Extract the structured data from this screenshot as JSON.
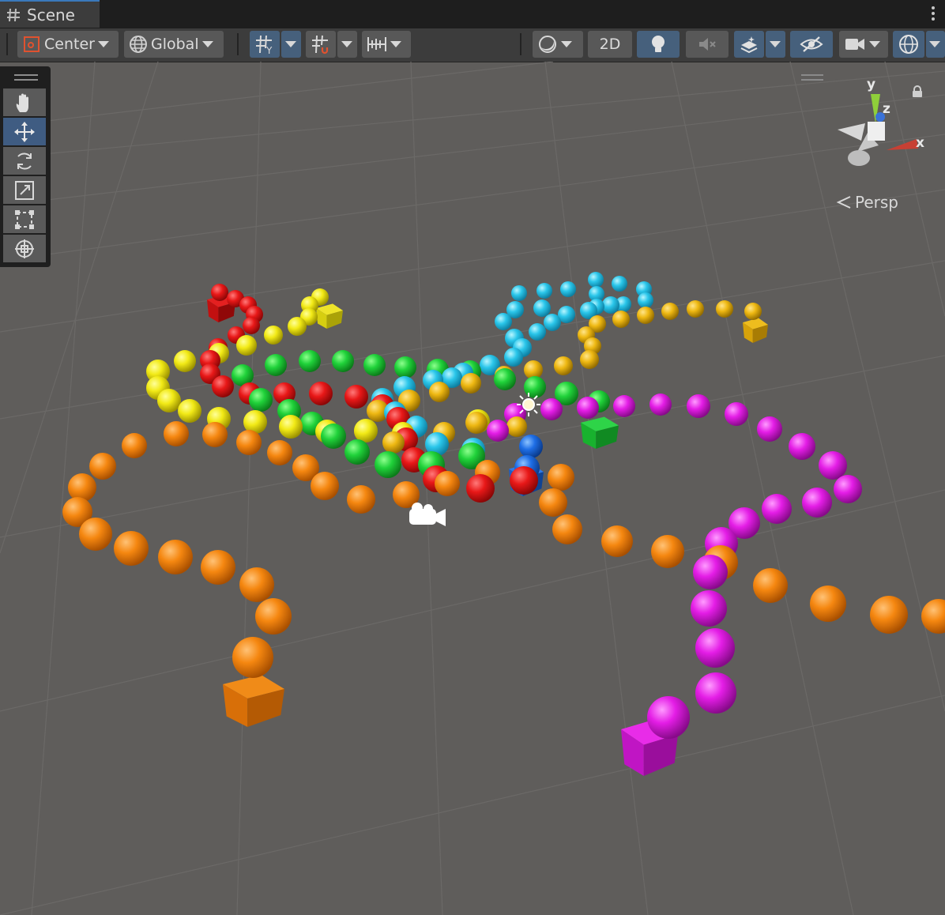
{
  "tab": {
    "label": "Scene",
    "icon": "grid-hash-icon"
  },
  "toolbar": {
    "pivot_label": "Center",
    "space_label": "Global",
    "mode_2d_label": "2D"
  },
  "tools": [
    "hand-tool",
    "move-tool",
    "rotate-tool",
    "scale-tool",
    "rect-tool",
    "transform-tool"
  ],
  "gizmo": {
    "y_label": "y",
    "z_label": "z",
    "x_label": "x",
    "projection_label": "Persp"
  },
  "colors": {
    "background": "#5f5d5b",
    "toolbar": "#3c3c3c",
    "active_button": "#46607c",
    "red": "#e01919",
    "yellow": "#f0e619",
    "green": "#1ed237",
    "cyan": "#28c8eb",
    "orange": "#f5870f",
    "magenta": "#e61ee6",
    "gold": "#f0b90f",
    "blue": "#1e6ee6"
  }
}
